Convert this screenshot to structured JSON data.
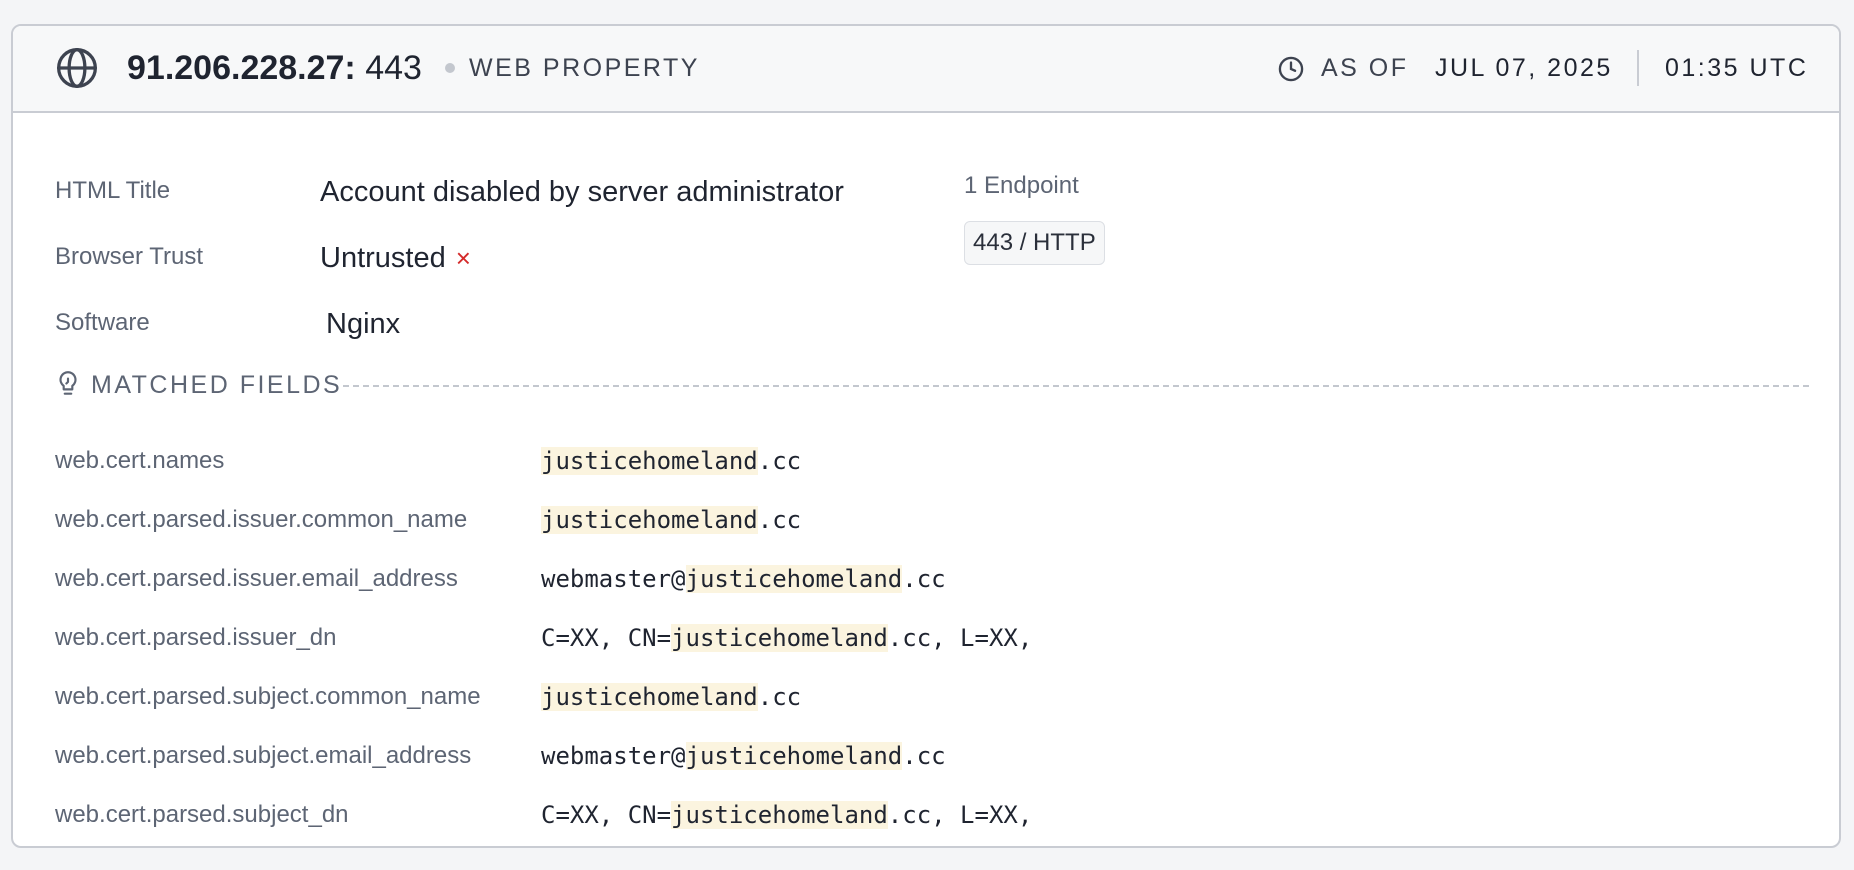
{
  "header": {
    "icon": "globe-icon",
    "ip": "91.206.228.27:",
    "port": "443",
    "kind": "WEB PROPERTY",
    "clock_icon": "clock-icon",
    "as_of_label": "AS OF",
    "date": "JUL 07, 2025",
    "time": "01:35 UTC"
  },
  "summary": {
    "html_title_label": "HTML Title",
    "html_title_value": "Account disabled by server administrator",
    "browser_trust_label": "Browser Trust",
    "browser_trust_value": "Untrusted",
    "browser_trust_mark": "×",
    "software_label": "Software",
    "software_value": "Nginx",
    "endpoints_label": "1 Endpoint",
    "endpoints": [
      "443 / HTTP"
    ]
  },
  "matched_fields": {
    "title": "MATCHED FIELDS",
    "icon": "lightbulb-icon",
    "rows": [
      {
        "key": "web.cert.names",
        "pre": "",
        "hl": "justicehomeland",
        "post": ".cc"
      },
      {
        "key": "web.cert.parsed.issuer.common_name",
        "pre": "",
        "hl": "justicehomeland",
        "post": ".cc"
      },
      {
        "key": "web.cert.parsed.issuer.email_address",
        "pre": "webmaster@",
        "hl": "justicehomeland",
        "post": ".cc"
      },
      {
        "key": "web.cert.parsed.issuer_dn",
        "pre": "C=XX, CN=",
        "hl": "justicehomeland",
        "post": ".cc, L=XX,"
      },
      {
        "key": "web.cert.parsed.subject.common_name",
        "pre": "",
        "hl": "justicehomeland",
        "post": ".cc"
      },
      {
        "key": "web.cert.parsed.subject.email_address",
        "pre": "webmaster@",
        "hl": "justicehomeland",
        "post": ".cc"
      },
      {
        "key": "web.cert.parsed.subject_dn",
        "pre": "C=XX, CN=",
        "hl": "justicehomeland",
        "post": ".cc, L=XX,"
      }
    ]
  },
  "colors": {
    "highlight": "#fbf4df",
    "untrusted": "#d42a2a",
    "border": "#c9ccd3"
  }
}
